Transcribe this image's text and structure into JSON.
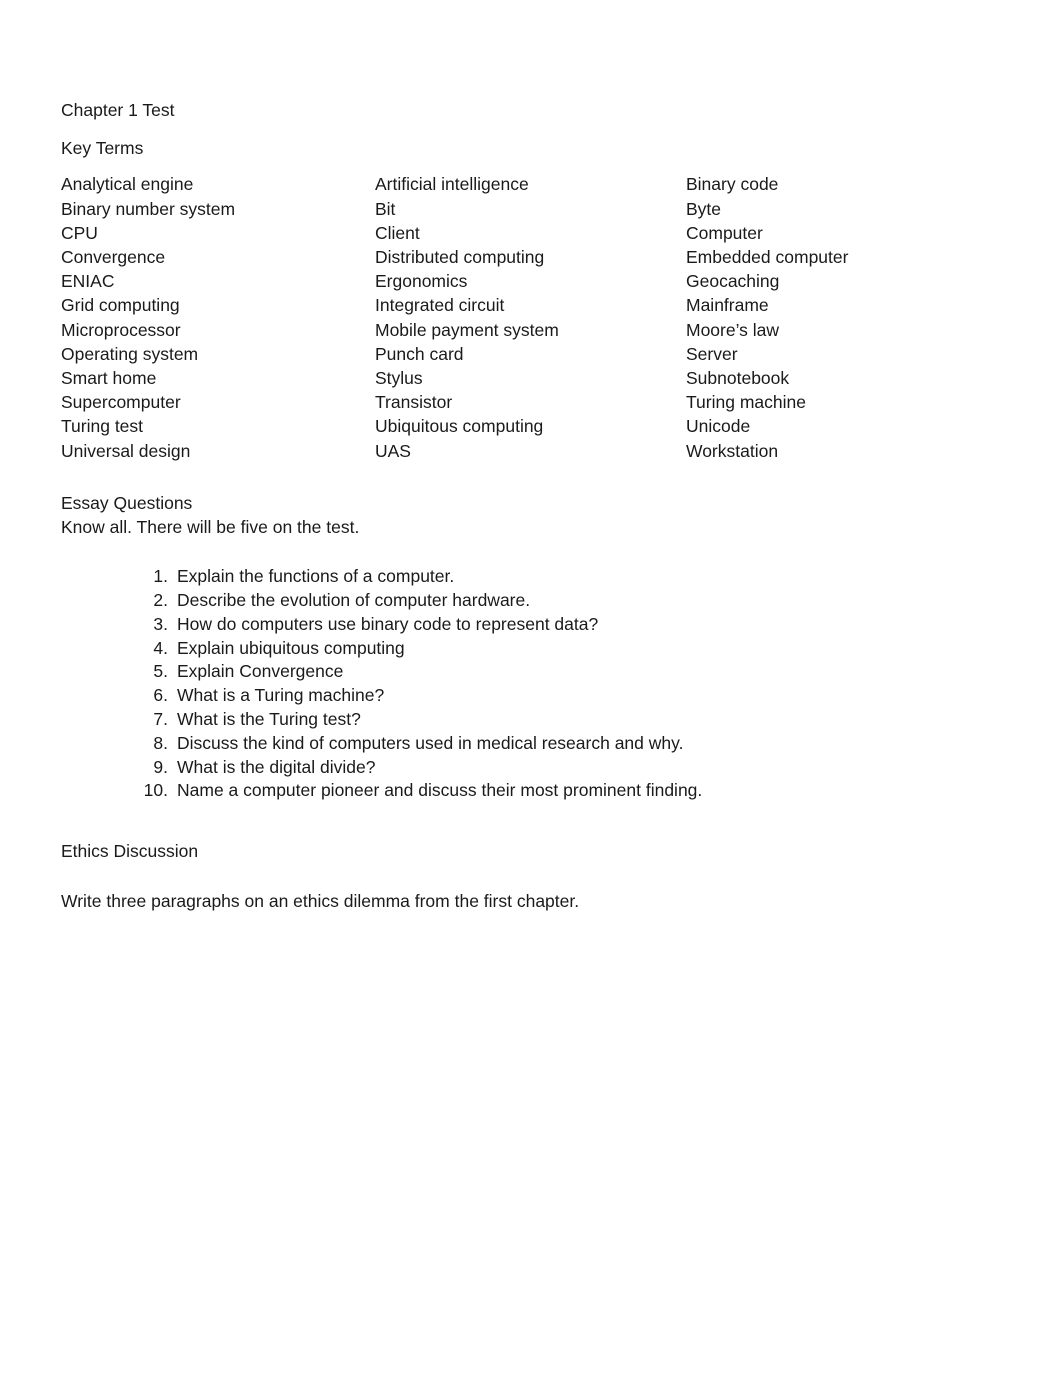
{
  "document": {
    "title": "Chapter 1 Test",
    "key_terms_heading": "Key Terms",
    "key_terms": {
      "columns": 3,
      "rows": [
        [
          "Analytical engine",
          "Artificial intelligence",
          "Binary code"
        ],
        [
          "Binary number system",
          "Bit",
          "Byte"
        ],
        [
          "CPU",
          "Client",
          "Computer"
        ],
        [
          "Convergence",
          "Distributed computing",
          "Embedded computer"
        ],
        [
          "ENIAC",
          "Ergonomics",
          "Geocaching"
        ],
        [
          "Grid computing",
          "Integrated circuit",
          "Mainframe"
        ],
        [
          "Microprocessor",
          "Mobile payment system",
          "Moore’s law"
        ],
        [
          "Operating system",
          "Punch card",
          "Server"
        ],
        [
          "Smart home",
          "Stylus",
          "Subnotebook"
        ],
        [
          "Supercomputer",
          "Transistor",
          "Turing machine"
        ],
        [
          "Turing test",
          "Ubiquitous computing",
          "Unicode"
        ],
        [
          "Universal design",
          "UAS",
          "Workstation"
        ]
      ]
    },
    "essay_heading": "Essay Questions",
    "essay_instruction": "Know all. There will be five on the test.",
    "essay_questions": [
      {
        "number": "1.",
        "text": "Explain the functions of a computer."
      },
      {
        "number": "2.",
        "text": "Describe the evolution of computer hardware."
      },
      {
        "number": "3.",
        "text": "How do computers use binary code to represent data?"
      },
      {
        "number": "4.",
        "text": "Explain ubiquitous computing"
      },
      {
        "number": "5.",
        "text": "Explain Convergence"
      },
      {
        "number": "6.",
        "text": "What is a Turing machine?"
      },
      {
        "number": "7.",
        "text": "What is the Turing test?"
      },
      {
        "number": "8.",
        "text": "Discuss the kind of computers used in medical research and why."
      },
      {
        "number": "9.",
        "text": "What is the digital divide?"
      },
      {
        "number": "10.",
        "text": "Name a computer pioneer and discuss their most prominent finding."
      }
    ],
    "ethics_heading": "Ethics Discussion",
    "ethics_body": "Write three paragraphs on an ethics dilemma from the first chapter."
  },
  "colors": {
    "text": "#1a1a1a",
    "page_background": "#ffffff"
  }
}
